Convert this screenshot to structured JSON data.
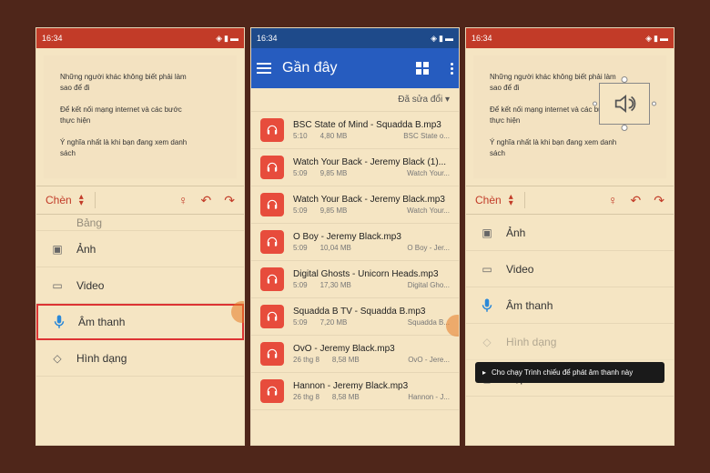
{
  "status": {
    "time": "16:34",
    "icons": "▯▯"
  },
  "slide": {
    "line1": "Những người khác không biết phải làm sao để đi",
    "line2": "Để kết nối mạng internet và các bước thực hiện",
    "line3": "Ý nghĩa nhất là khi bạn đang xem danh sách"
  },
  "tab": {
    "label": "Chèn"
  },
  "menu": {
    "bang": "Bảng",
    "anh": "Ảnh",
    "video": "Video",
    "audio": "Âm thanh",
    "shape": "Hình dạng",
    "textbox": "Hộp Văn bản"
  },
  "picker": {
    "title": "Gần đây",
    "sort": "Đã sửa đổi",
    "files": [
      {
        "name": "BSC State of Mind - Squadda B.mp3",
        "dur": "5:10",
        "size": "4,80 MB",
        "sub": "BSC State o..."
      },
      {
        "name": "Watch Your Back - Jeremy Black (1)...",
        "dur": "5:09",
        "size": "9,85 MB",
        "sub": "Watch Your..."
      },
      {
        "name": "Watch Your Back - Jeremy Black.mp3",
        "dur": "5:09",
        "size": "9,85 MB",
        "sub": "Watch Your..."
      },
      {
        "name": "O Boy - Jeremy Black.mp3",
        "dur": "5:09",
        "size": "10,04 MB",
        "sub": "O Boy - Jer..."
      },
      {
        "name": "Digital Ghosts - Unicorn Heads.mp3",
        "dur": "5:09",
        "size": "17,30 MB",
        "sub": "Digital Gho..."
      },
      {
        "name": "Squadda B TV - Squadda B.mp3",
        "dur": "5:09",
        "size": "7,20 MB",
        "sub": "Squadda B..."
      },
      {
        "name": "OvO - Jeremy Black.mp3",
        "dur": "26 thg 8",
        "size": "8,58 MB",
        "sub": "OvO - Jere..."
      },
      {
        "name": "Hannon - Jeremy Black.mp3",
        "dur": "26 thg 8",
        "size": "8,58 MB",
        "sub": "Hannon - J..."
      }
    ]
  },
  "tooltip": "Cho chạy Trình chiếu để phát âm thanh này"
}
